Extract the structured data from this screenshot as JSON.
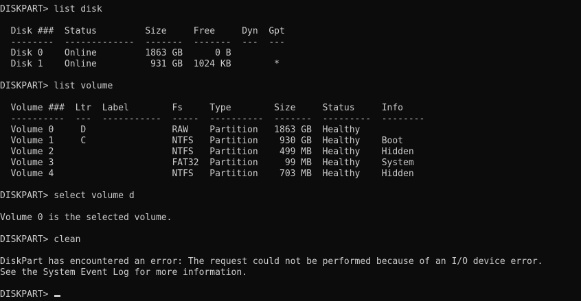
{
  "console": {
    "lines": [
      "DISKPART> list disk",
      "",
      "  Disk ###  Status         Size     Free     Dyn  Gpt",
      "  --------  -------------  -------  -------  ---  ---",
      "  Disk 0    Online         1863 GB      0 B",
      "  Disk 1    Online          931 GB  1024 KB        *",
      "",
      "DISKPART> list volume",
      "",
      "  Volume ###  Ltr  Label        Fs     Type        Size     Status     Info",
      "  ----------  ---  -----------  -----  ----------  -------  ---------  --------",
      "  Volume 0     D                RAW    Partition   1863 GB  Healthy",
      "  Volume 1     C                NTFS   Partition    930 GB  Healthy    Boot",
      "  Volume 2                      NTFS   Partition    499 MB  Healthy    Hidden",
      "  Volume 3                      FAT32  Partition     99 MB  Healthy    System",
      "  Volume 4                      NTFS   Partition    703 MB  Healthy    Hidden",
      "",
      "DISKPART> select volume d",
      "",
      "Volume 0 is the selected volume.",
      "",
      "DISKPART> clean",
      "",
      "DiskPart has encountered an error: The request could not be performed because of an I/O device error.",
      "See the System Event Log for more information.",
      ""
    ],
    "prompt": "DISKPART> "
  },
  "colors": {
    "background": "#0c0c0c",
    "foreground": "#cccccc"
  }
}
